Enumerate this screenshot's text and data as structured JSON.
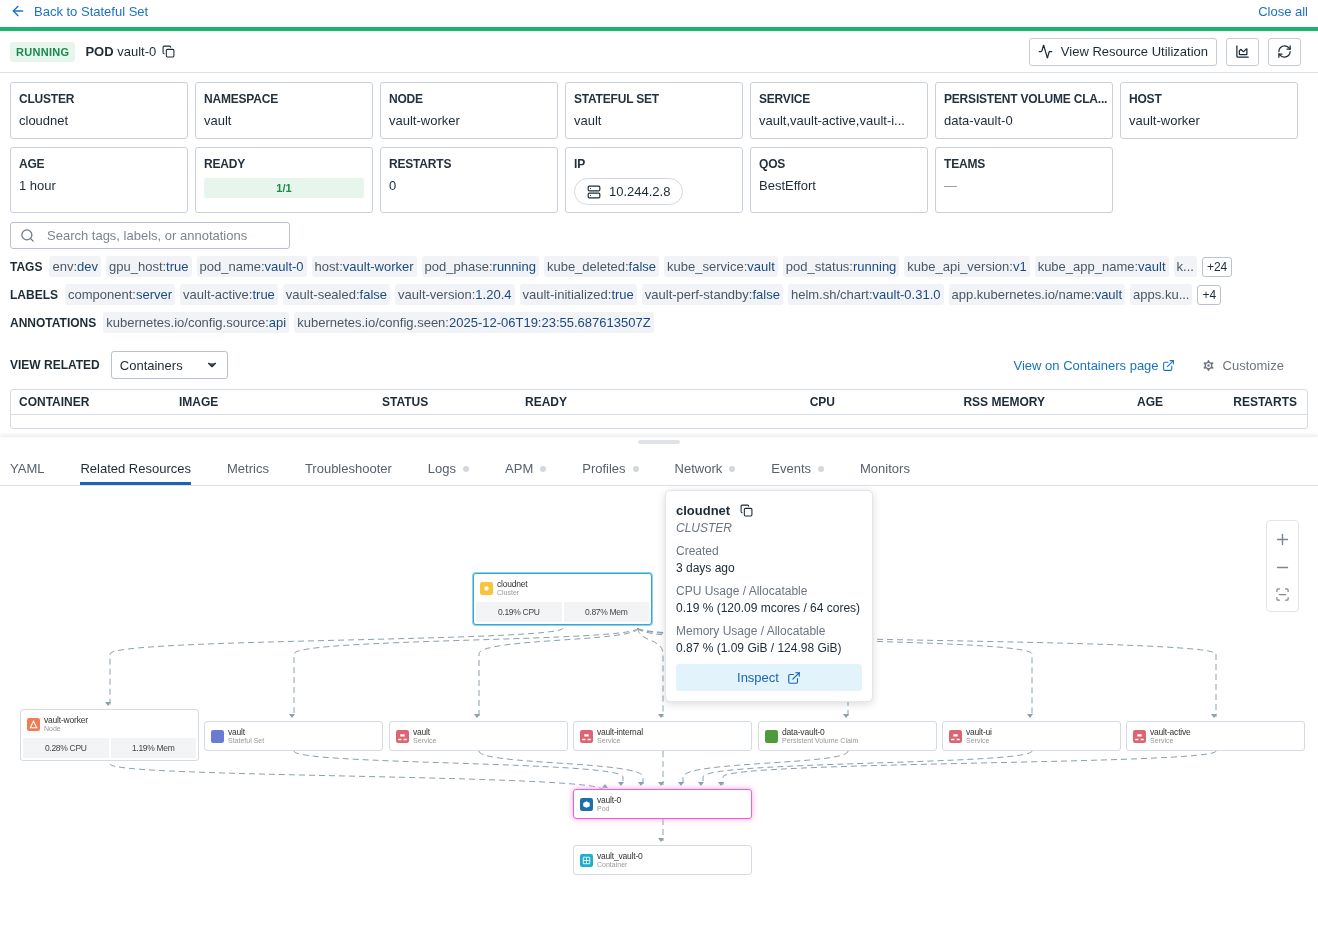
{
  "nav": {
    "back": "Back to Stateful Set",
    "close": "Close all"
  },
  "header": {
    "status": "RUNNING",
    "kind": "POD",
    "name": "vault-0",
    "buttons": [
      {
        "kind": "utilization",
        "label": "View Resource Utilization"
      },
      {
        "kind": "chart"
      },
      {
        "kind": "refresh"
      }
    ]
  },
  "cards": [
    {
      "kind": "text",
      "label": "CLUSTER",
      "value": "cloudnet"
    },
    {
      "kind": "text",
      "label": "NAMESPACE",
      "value": "vault"
    },
    {
      "kind": "text",
      "label": "NODE",
      "value": "vault-worker"
    },
    {
      "kind": "text",
      "label": "STATEFUL SET",
      "value": "vault"
    },
    {
      "kind": "text",
      "label": "SERVICE",
      "value": "vault,vault-active,vault-i..."
    },
    {
      "kind": "text",
      "label": "PERSISTENT VOLUME CLA...",
      "value": "data-vault-0"
    },
    {
      "kind": "text",
      "label": "HOST",
      "value": "vault-worker"
    },
    {
      "kind": "text",
      "label": "AGE",
      "value": "1 hour"
    },
    {
      "kind": "ratio",
      "label": "READY",
      "value": "1/1",
      "level": 1
    },
    {
      "kind": "text",
      "label": "RESTARTS",
      "value": "0"
    },
    {
      "kind": "chip",
      "label": "IP",
      "value": "10.244.2.8"
    },
    {
      "kind": "text",
      "label": "QOS",
      "value": "BestEffort"
    },
    {
      "kind": "muted",
      "label": "TEAMS",
      "value": "—"
    }
  ],
  "search": {
    "placeholder": "Search tags, labels, or annotations"
  },
  "tag_groups": [
    {
      "title": "TAGS",
      "more": "+24",
      "items": [
        {
          "key": "env:",
          "value": "dev"
        },
        {
          "key": "gpu_host:",
          "value": "true"
        },
        {
          "key": "pod_name:",
          "value": "vault-0"
        },
        {
          "key": "host:",
          "value": "vault-worker"
        },
        {
          "key": "pod_phase:",
          "value": "running"
        },
        {
          "key": "kube_deleted:",
          "value": "false"
        },
        {
          "key": "kube_service:",
          "value": "vault"
        },
        {
          "key": "pod_status:",
          "value": "running"
        },
        {
          "key": "kube_api_version:",
          "value": "v1"
        },
        {
          "key": "kube_app_name:",
          "value": "vault"
        },
        {
          "key": "k..."
        }
      ]
    },
    {
      "title": "LABELS",
      "more": "+4",
      "items": [
        {
          "key": "component:",
          "value": "server"
        },
        {
          "key": "vault-active:",
          "value": "true"
        },
        {
          "key": "vault-sealed:",
          "value": "false"
        },
        {
          "key": "vault-version:",
          "value": "1.20.4"
        },
        {
          "key": "vault-initialized:",
          "value": "true"
        },
        {
          "key": "vault-perf-standby:",
          "value": "false"
        },
        {
          "key": "helm.sh/chart:",
          "value": "vault-0.31.0"
        },
        {
          "key": "app.kubernetes.io/name:",
          "value": "vault"
        },
        {
          "key": "apps.ku..."
        }
      ]
    },
    {
      "title": "ANNOTATIONS",
      "items": [
        {
          "key": "kubernetes.io/config.source:",
          "value": "api"
        },
        {
          "key": "kubernetes.io/config.seen:",
          "value": "2025-12-06T19:23:55.687613507Z"
        }
      ]
    }
  ],
  "related": {
    "label": "VIEW RELATED",
    "select": "Containers",
    "link": "View on Containers page",
    "customize": "Customize"
  },
  "table": {
    "columns": [
      "CONTAINER",
      "IMAGE",
      "STATUS",
      "READY",
      "CPU",
      "RSS MEMORY",
      "AGE",
      "RESTARTS"
    ]
  },
  "tabs": [
    {
      "label": "YAML",
      "selected": false,
      "indicator": false
    },
    {
      "label": "Related Resources",
      "selected": true,
      "indicator": false
    },
    {
      "label": "Metrics",
      "selected": false,
      "indicator": false
    },
    {
      "label": "Troubleshooter",
      "selected": false,
      "indicator": false
    },
    {
      "label": "Logs",
      "selected": false,
      "indicator": true
    },
    {
      "label": "APM",
      "selected": false,
      "indicator": true
    },
    {
      "label": "Profiles",
      "selected": false,
      "indicator": true
    },
    {
      "label": "Network",
      "selected": false,
      "indicator": true
    },
    {
      "label": "Events",
      "selected": false,
      "indicator": true
    },
    {
      "label": "Monitors",
      "selected": false,
      "indicator": false
    }
  ],
  "nodes": [
    {
      "kind": "cluster",
      "name": "cloudnet",
      "type": "Cluster",
      "color": "#f9c43a",
      "cpu": "0.19% CPU",
      "mem": "0.87% Mem",
      "selected": true,
      "current": false
    },
    {
      "kind": "node",
      "name": "vault-worker",
      "type": "Node",
      "color": "#ee7d55",
      "cpu": "0.28% CPU",
      "mem": "1.19% Mem",
      "selected": false,
      "current": false
    },
    {
      "kind": "statefulset",
      "name": "vault",
      "type": "Stateful Set",
      "color": "#6a7bd1",
      "selected": false,
      "current": false
    },
    {
      "kind": "service",
      "name": "vault",
      "type": "Service",
      "color": "#d96672",
      "selected": false,
      "current": false
    },
    {
      "kind": "service",
      "name": "vault-internal",
      "type": "Service",
      "color": "#d96672",
      "selected": false,
      "current": false
    },
    {
      "kind": "pvc",
      "name": "data-vault-0",
      "type": "Persistent Volume Claim",
      "color": "#4f9a3a",
      "selected": false,
      "current": false
    },
    {
      "kind": "service",
      "name": "vault-ui",
      "type": "Service",
      "color": "#d96672",
      "selected": false,
      "current": false
    },
    {
      "kind": "service",
      "name": "vault-active",
      "type": "Service",
      "color": "#d96672",
      "selected": false,
      "current": false
    },
    {
      "kind": "pod",
      "name": "vault-0",
      "type": "Pod",
      "color": "#1c6fa8",
      "selected": false,
      "current": true
    },
    {
      "kind": "container",
      "name": "vault_vault-0",
      "type": "Container",
      "color": "#1eaecb",
      "selected": false,
      "current": false
    }
  ],
  "popover": {
    "title": "cloudnet",
    "subtitle": "CLUSTER",
    "fields": [
      {
        "label": "Created",
        "value": "3 days ago"
      },
      {
        "label": "CPU Usage / Allocatable",
        "value": "0.19 % (120.09 mcores / 64 cores)"
      },
      {
        "label": "Memory Usage / Allocatable",
        "value": "0.87 % (1.09 GiB / 124.98 GiB)"
      }
    ],
    "action": "Inspect"
  }
}
